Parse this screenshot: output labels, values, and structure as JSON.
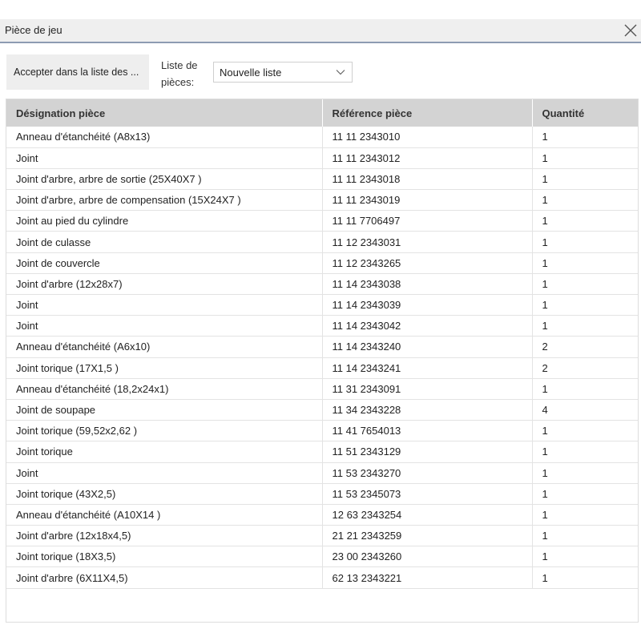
{
  "dialog": {
    "title": "Pièce de jeu"
  },
  "toolbar": {
    "accept_label": "Accepter dans la liste des ...",
    "list_label": "Liste de pièces:",
    "list_selected": "Nouvelle liste"
  },
  "table": {
    "headers": {
      "designation": "Désignation pièce",
      "reference": "Référence pièce",
      "quantity": "Quantité"
    },
    "rows": [
      {
        "designation": "Anneau d'étanchéité (A8x13)",
        "reference": "11 11 2343010",
        "quantity": "1"
      },
      {
        "designation": "Joint",
        "reference": "11 11 2343012",
        "quantity": "1"
      },
      {
        "designation": "Joint d'arbre, arbre de sortie (25X40X7 )",
        "reference": "11 11 2343018",
        "quantity": "1"
      },
      {
        "designation": "Joint d'arbre, arbre de compensation (15X24X7 )",
        "reference": "11 11 2343019",
        "quantity": "1"
      },
      {
        "designation": "Joint au pied du cylindre",
        "reference": "11 11 7706497",
        "quantity": "1"
      },
      {
        "designation": "Joint de culasse",
        "reference": "11 12 2343031",
        "quantity": "1"
      },
      {
        "designation": "Joint de couvercle",
        "reference": "11 12 2343265",
        "quantity": "1"
      },
      {
        "designation": "Joint d'arbre (12x28x7)",
        "reference": "11 14 2343038",
        "quantity": "1"
      },
      {
        "designation": "Joint",
        "reference": "11 14 2343039",
        "quantity": "1"
      },
      {
        "designation": "Joint",
        "reference": "11 14 2343042",
        "quantity": "1"
      },
      {
        "designation": "Anneau d'étanchéité (A6x10)",
        "reference": "11 14 2343240",
        "quantity": "2"
      },
      {
        "designation": "Joint torique (17X1,5 )",
        "reference": "11 14 2343241",
        "quantity": "2"
      },
      {
        "designation": "Anneau d'étanchéité (18,2x24x1)",
        "reference": "11 31 2343091",
        "quantity": "1"
      },
      {
        "designation": "Joint de soupape",
        "reference": "11 34 2343228",
        "quantity": "4"
      },
      {
        "designation": "Joint torique (59,52x2,62 )",
        "reference": "11 41 7654013",
        "quantity": "1"
      },
      {
        "designation": "Joint torique",
        "reference": "11 51 2343129",
        "quantity": "1"
      },
      {
        "designation": "Joint",
        "reference": "11 53 2343270",
        "quantity": "1"
      },
      {
        "designation": "Joint torique (43X2,5)",
        "reference": "11 53 2345073",
        "quantity": "1"
      },
      {
        "designation": "Anneau d'étanchéité (A10X14 )",
        "reference": "12 63 2343254",
        "quantity": "1"
      },
      {
        "designation": "Joint d'arbre (12x18x4,5)",
        "reference": "21 21 2343259",
        "quantity": "1"
      },
      {
        "designation": "Joint torique (18X3,5)",
        "reference": "23 00 2343260",
        "quantity": "1"
      },
      {
        "designation": "Joint d'arbre (6X11X4,5)",
        "reference": "62 13 2343221",
        "quantity": "1"
      }
    ]
  },
  "icons": {
    "close": "close-icon",
    "dropdown": "chevron-down-icon"
  }
}
